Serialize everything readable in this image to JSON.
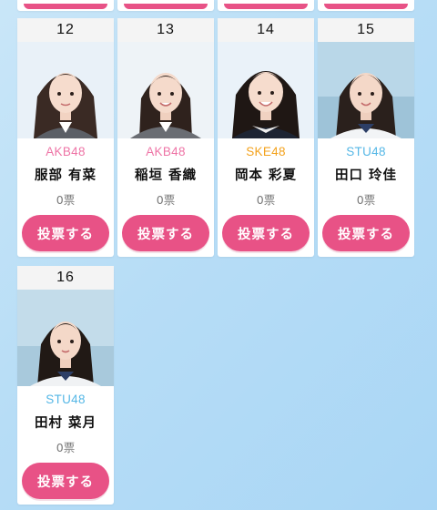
{
  "colors": {
    "AKB48": "#ee74a6",
    "SKE48": "#f3a21d",
    "STU48": "#55b7e6",
    "vote_button": "#e85286"
  },
  "vote_label": "投票する",
  "members": [
    {
      "rank": "12",
      "group": "AKB48",
      "name": "服部 有菜",
      "votes": "0票",
      "icon": "member-photo"
    },
    {
      "rank": "13",
      "group": "AKB48",
      "name": "稲垣 香織",
      "votes": "0票",
      "icon": "member-photo"
    },
    {
      "rank": "14",
      "group": "SKE48",
      "name": "岡本 彩夏",
      "votes": "0票",
      "icon": "member-photo"
    },
    {
      "rank": "15",
      "group": "STU48",
      "name": "田口 玲佳",
      "votes": "0票",
      "icon": "member-photo"
    },
    {
      "rank": "16",
      "group": "STU48",
      "name": "田村 菜月",
      "votes": "0票",
      "icon": "member-photo"
    }
  ]
}
